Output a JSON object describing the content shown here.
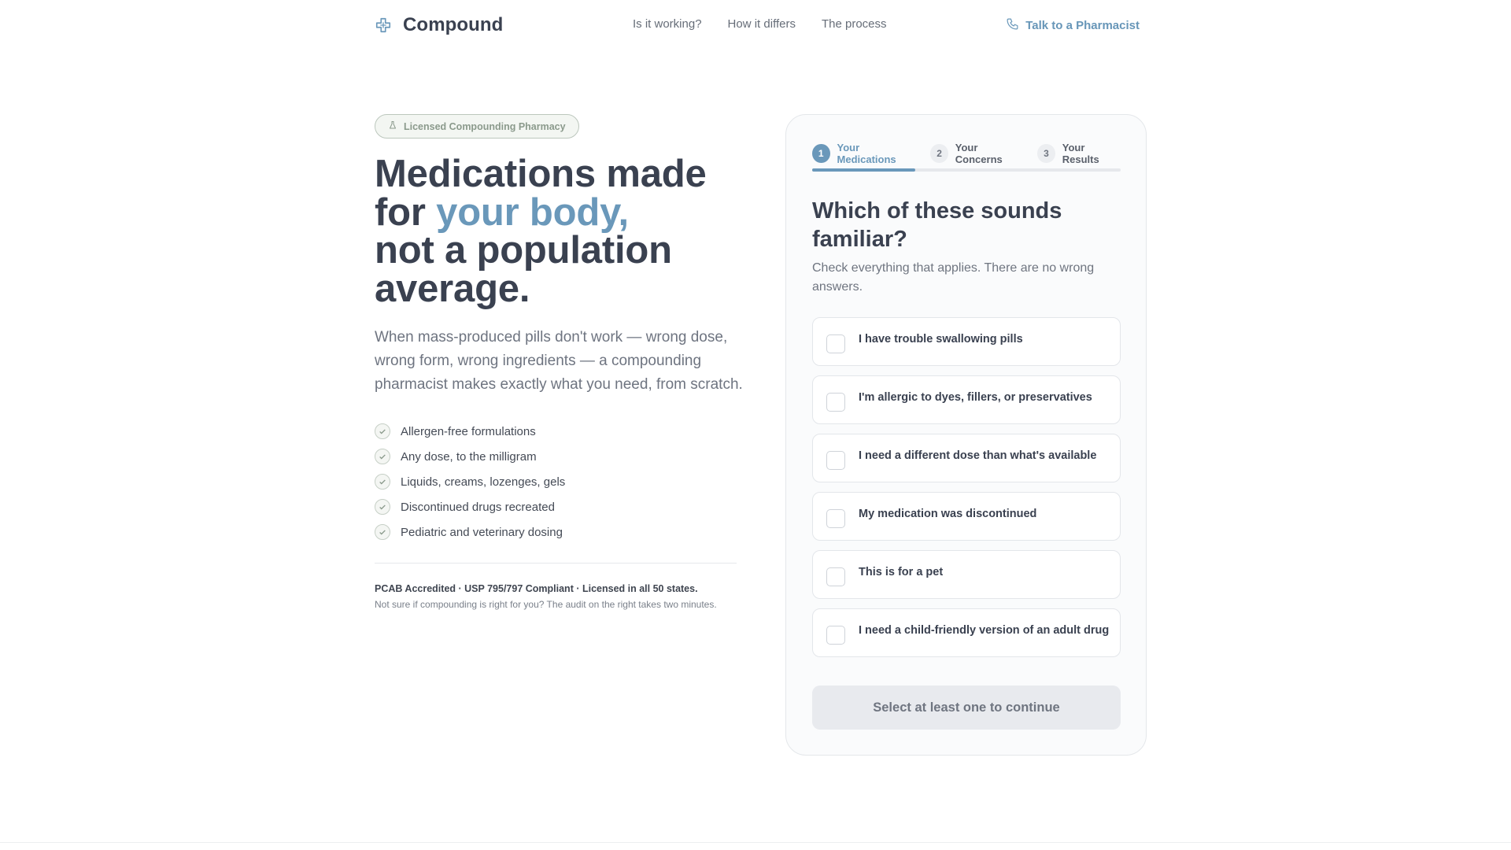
{
  "header": {
    "brand_name": "Compound",
    "brand_icon": "medical-cross-icon",
    "nav": [
      {
        "label": "Is it working?"
      },
      {
        "label": "How it differs"
      },
      {
        "label": "The process"
      }
    ],
    "cta_label": "Talk to a Pharmacist",
    "cta_icon": "phone-icon"
  },
  "hero": {
    "badge_label": "Licensed Compounding Pharmacy",
    "badge_icon": "flask-icon",
    "title_line1": "Medications made",
    "title_for": "for ",
    "title_accent": "your body,",
    "title_line3": "not a population",
    "title_line4": "average.",
    "subtitle": "When mass-produced pills don't work — wrong dose, wrong form, wrong ingredients — a compounding pharmacist makes exactly what you need, from scratch.",
    "features": [
      "Allergen-free formulations",
      "Any dose, to the milligram",
      "Liquids, creams, lozenges, gels",
      "Discontinued drugs recreated",
      "Pediatric and veterinary dosing"
    ],
    "credentials": "PCAB Accredited · USP 795/797 Compliant · Licensed in all 50 states.",
    "note": "Not sure if compounding is right for you? The audit on the right takes two minutes."
  },
  "quiz": {
    "steps": [
      {
        "number": "1",
        "label": "Your Medications",
        "active": true
      },
      {
        "number": "2",
        "label": "Your Concerns",
        "active": false
      },
      {
        "number": "3",
        "label": "Your Results",
        "active": false
      }
    ],
    "progress_fraction": 0.333,
    "question": "Which of these sounds familiar?",
    "instructions": "Check everything that applies. There are no wrong answers.",
    "options": [
      {
        "label": "I have trouble swallowing pills",
        "checked": false
      },
      {
        "label": "I'm allergic to dyes, fillers, or preservatives",
        "checked": false
      },
      {
        "label": "I need a different dose than what's available",
        "checked": false
      },
      {
        "label": "My medication was discontinued",
        "checked": false
      },
      {
        "label": "This is for a pet",
        "checked": false
      },
      {
        "label": "I need a child-friendly version of an adult drug",
        "checked": false
      }
    ],
    "continue_label": "Select at least one to continue",
    "continue_disabled": true
  },
  "colors": {
    "accent": "#6a98ba",
    "heading": "#3a4150",
    "muted": "#6f7580",
    "badge_green": "#8b9a8c"
  }
}
